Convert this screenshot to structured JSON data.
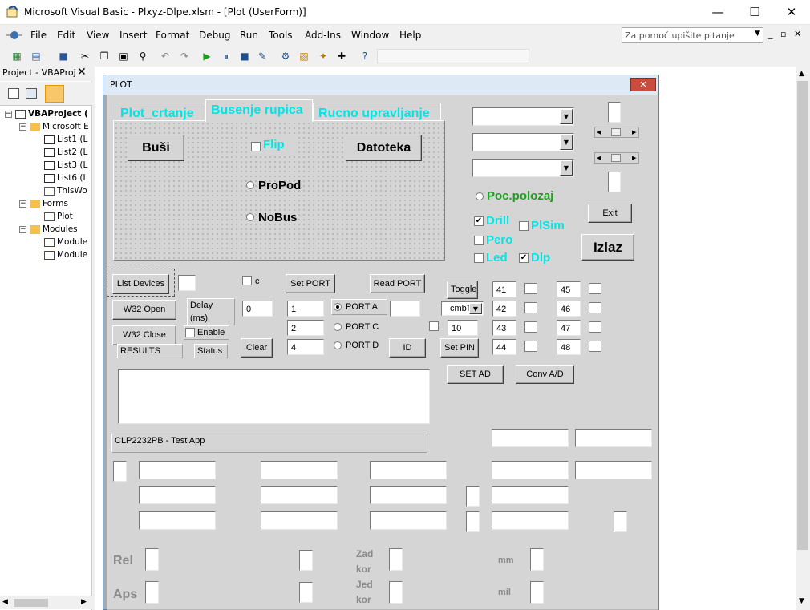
{
  "window": {
    "title": "Microsoft Visual Basic - Plxyz-Dlpe.xlsm - [Plot (UserForm)]",
    "minimize": "—",
    "maximize": "☐",
    "close": "✕"
  },
  "menubar": {
    "items": [
      "File",
      "Edit",
      "View",
      "Insert",
      "Format",
      "Debug",
      "Run",
      "Tools",
      "Add-Ins",
      "Window",
      "Help"
    ],
    "help_placeholder": "Za pomoć upišite pitanje",
    "child_controls": [
      "_",
      "▫",
      "✕"
    ]
  },
  "project": {
    "title": "Project - VBAProj",
    "close": "✕",
    "tree": [
      {
        "label": "VBAProject (",
        "depth": 0,
        "kind": "project"
      },
      {
        "label": "Microsoft E",
        "depth": 1,
        "kind": "folder"
      },
      {
        "label": "List1 (L",
        "depth": 2,
        "kind": "sheet"
      },
      {
        "label": "List2 (L",
        "depth": 2,
        "kind": "sheet"
      },
      {
        "label": "List3 (L",
        "depth": 2,
        "kind": "sheet"
      },
      {
        "label": "List6 (L",
        "depth": 2,
        "kind": "sheet"
      },
      {
        "label": "ThisWo",
        "depth": 2,
        "kind": "workbook"
      },
      {
        "label": "Forms",
        "depth": 1,
        "kind": "folder"
      },
      {
        "label": "Plot",
        "depth": 2,
        "kind": "form"
      },
      {
        "label": "Modules",
        "depth": 1,
        "kind": "folder"
      },
      {
        "label": "Module",
        "depth": 2,
        "kind": "module"
      },
      {
        "label": "Module",
        "depth": 2,
        "kind": "module"
      }
    ]
  },
  "form": {
    "title": "PLOT",
    "close": "✕",
    "tabs": [
      "Plot_crtanje",
      "Busenje rupica",
      "Rucno upravljanje"
    ],
    "active_tab": 1,
    "tabpage": {
      "busi": "Buši",
      "flip": "Flip",
      "datoteka": "Datoteka",
      "propod": "ProPod",
      "nobus": "NoBus"
    },
    "right": {
      "poc_polozaj": "Poc.polozaj",
      "drill": "Drill",
      "plsim": "PlSim",
      "pero": "Pero",
      "led": "Led",
      "dlp": "Dlp",
      "exit": "Exit",
      "izlaz": "Izlaz"
    },
    "device": {
      "list_devices": "List  Devices",
      "w32_open": "W32  Open",
      "w32_close": "W32  Close",
      "delay_label": "Delay (ms)",
      "delay_value": "0",
      "enable": "Enable",
      "results": "RESULTS",
      "status": "Status",
      "clear": "Clear",
      "c_check": "c",
      "set_port": "Set PORT",
      "read_port": "Read PORT",
      "port_a": "PORT A",
      "port_c": "PORT C",
      "port_d": "PORT D",
      "id": "ID",
      "v1": "1",
      "v2": "2",
      "v4": "4",
      "toggle": "Toggle",
      "cmb": "cmbT",
      "pin_value": "10",
      "set_pin": "Set PIN",
      "pins": [
        "41",
        "42",
        "43",
        "44",
        "45",
        "46",
        "47",
        "48"
      ],
      "set_ad": "SET AD",
      "conv_ad": "Conv A/D"
    },
    "status_text": "CLP2232PB - Test App",
    "bottom": {
      "rel": "Rel",
      "aps": "Aps",
      "zad_kor": "Zad kor",
      "jed_kor": "Jed kor",
      "mm": "mm",
      "mil": "mil"
    }
  }
}
